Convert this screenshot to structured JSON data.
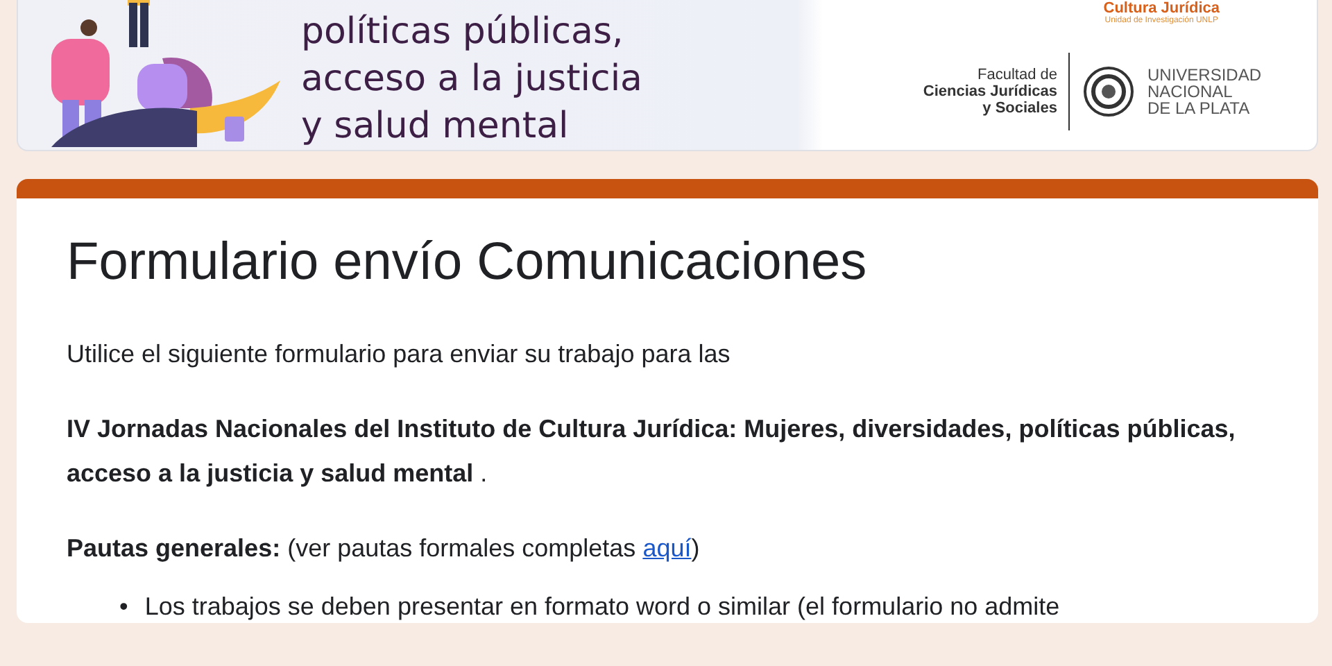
{
  "banner": {
    "title_lines": [
      "políticas públicas,",
      "acceso a la justicia",
      "y salud mental"
    ],
    "unit": {
      "name": "Cultura Jurídica",
      "subtitle": "Unidad de Investigación UNLP"
    },
    "faculty_lines": [
      "Facultad de",
      "Ciencias Jurídicas",
      "y Sociales"
    ],
    "university_lines": [
      "UNIVERSIDAD",
      "NACIONAL",
      "DE LA PLATA"
    ]
  },
  "form": {
    "title": "Formulario envío Comunicaciones",
    "intro": "Utilice el siguiente formulario para enviar su trabajo para las",
    "event": "**IV Jornadas Nacionales del Instituto de Cultura Jurídica: Mujeres, diversidades, políticas públicas, acceso a la justicia y salud mental** .",
    "guidelines": {
      "text": "**Pautas generales:** (ver pautas formales completas ",
      "link": "aquí",
      "after": ")"
    },
    "bullets": [
      {
        "marker": "•",
        "text": "Los trabajos se deben presentar en formato word o similar (el formulario no admite"
      }
    ]
  }
}
